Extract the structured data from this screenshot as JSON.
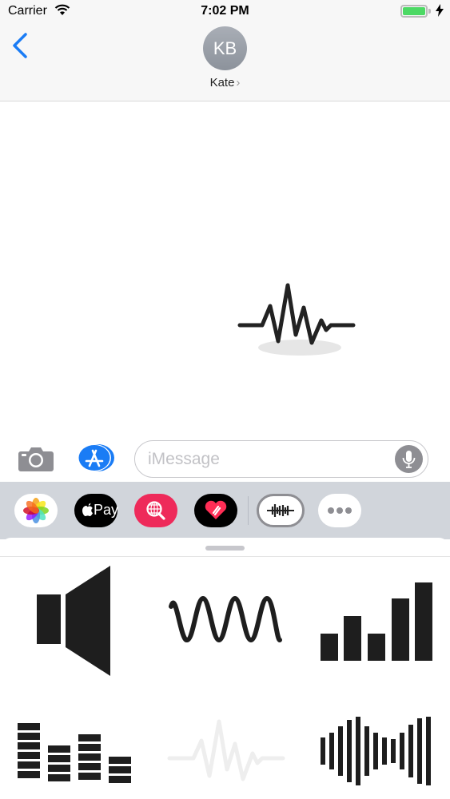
{
  "status_bar": {
    "carrier": "Carrier",
    "time": "7:02 PM",
    "battery_level": 1.0,
    "battery_color": "#4cd964"
  },
  "nav": {
    "avatar_initials": "KB",
    "contact_name": "Kate",
    "contact_chevron": "›",
    "accent_color": "#1a7cf5"
  },
  "input_bar": {
    "message_placeholder": "iMessage",
    "camera_icon": "camera-icon",
    "apps_icon": "app-store-icon",
    "mic_icon": "microphone-icon"
  },
  "app_drawer": {
    "items": [
      {
        "name": "photos-app-icon",
        "selected": false
      },
      {
        "name": "apple-pay-app-icon",
        "label": "Pay",
        "selected": false
      },
      {
        "name": "web-images-search-app-icon",
        "selected": false
      },
      {
        "name": "digital-touch-app-icon",
        "selected": false
      },
      {
        "name": "sound-wave-sticker-app-icon",
        "selected": true
      },
      {
        "name": "more-apps-icon",
        "selected": false
      }
    ]
  },
  "conversation": {
    "sent_sticker": "heartbeat-wave-sticker"
  },
  "sticker_panel": {
    "stickers": [
      "speaker-sticker",
      "sine-wave-sticker",
      "ascending-bars-sticker",
      "equalizer-blocks-sticker",
      "heartbeat-wave-sticker",
      "audio-waveform-sticker"
    ]
  }
}
